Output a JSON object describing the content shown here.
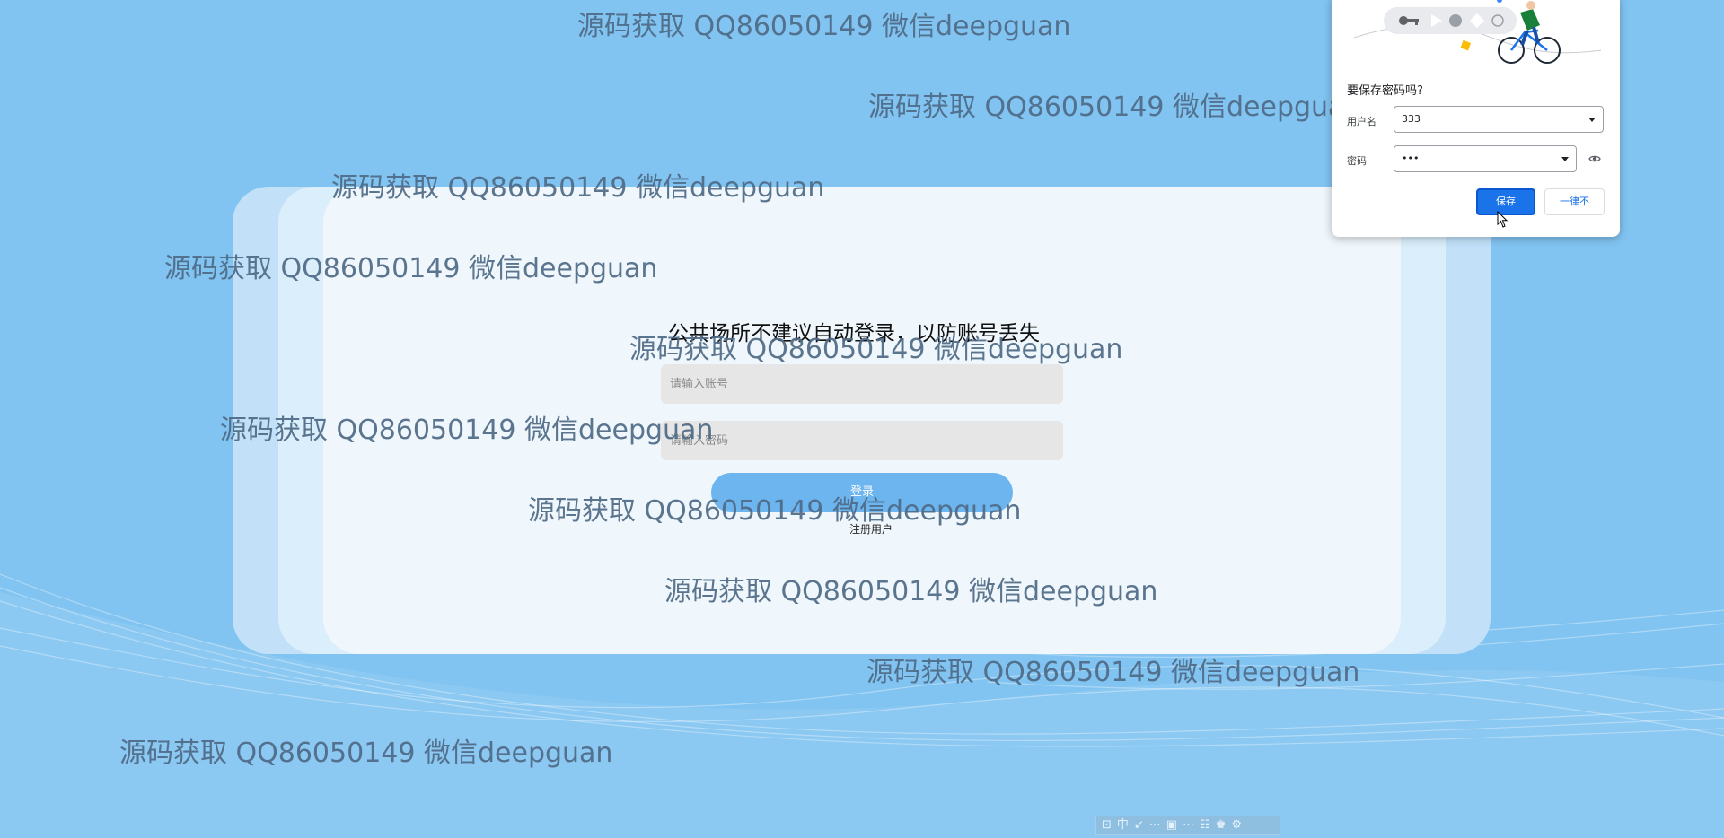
{
  "login": {
    "notice": "公共场所不建议自动登录，以防账号丢失",
    "username_placeholder": "请输入账号",
    "password_placeholder": "请输入密码",
    "login_button": "登录",
    "register_link": "注册用户"
  },
  "watermark": {
    "text": "源码获取 QQ86050149 微信deepguan"
  },
  "password_popup": {
    "title": "要保存密码吗?",
    "username_label": "用户名",
    "username_value": "333",
    "password_label": "密码",
    "password_value": "•••",
    "save_button": "保存",
    "never_button": "一律不"
  },
  "ime_toolbar": {
    "glyphs": "⊡中↙⋯▣⋯☷♚⚙",
    "mode": "中"
  },
  "colors": {
    "background": "#82c4f1",
    "card": "#eff7fc",
    "login_button": "#6cb5ef",
    "save_button": "#1a73e8",
    "watermark": "#4f6a86"
  }
}
